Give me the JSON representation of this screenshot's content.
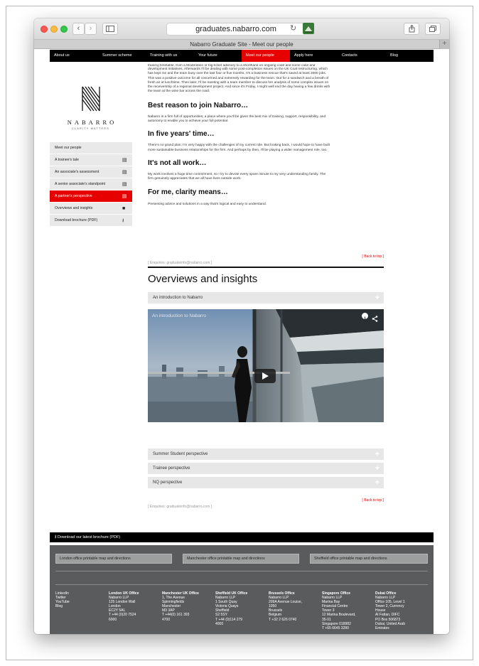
{
  "browser": {
    "url": "graduates.nabarro.com",
    "tab_title": "Nabarro Graduate Site - Meet our people",
    "back": "‹",
    "forward": "›",
    "reload": "↻",
    "new_tab": "+"
  },
  "nav": {
    "items": [
      "About us",
      "Summer scheme",
      "Training with us",
      "Your future",
      "Meet our people",
      "Apply here",
      "Contacts",
      "Blog"
    ],
    "active_index": 4,
    "active_color": "#e60000"
  },
  "logo": {
    "name": "NABARRO",
    "tagline": "CLARITY MATTERS"
  },
  "sidebar": {
    "items": [
      {
        "label": "Meet our people",
        "icon": ""
      },
      {
        "label": "A trainee's tale",
        "icon": "document-icon"
      },
      {
        "label": "An associate's assessment",
        "icon": "document-icon"
      },
      {
        "label": "A senior associate's standpoint",
        "icon": "document-icon"
      },
      {
        "label": "A partner's perspective",
        "icon": "document-icon"
      },
      {
        "label": "Overviews and insights",
        "icon": "video-icon"
      },
      {
        "label": "Download brochure (PDF)",
        "icon": "download-icon"
      }
    ],
    "active_index": 4
  },
  "article": {
    "intro_lines": [
      "training timetable, from a Moderation or big-ticket advisory to a shorthand on ongoing code and some case and",
      "development initiatives. Afterwards I'll be dealing with some post-completion issues on the UK Coal restructuring, which",
      "has kept me and the team busy over the last four or five months. It's a business rescue that's saved at least 2000 jobs.",
      "This was a positive outcome for all concerned and extremely rewarding for the team. Out for a sandwich and a breath of",
      "fresh air at lunchtime. Then later, I'll be meeting with a team member to discuss her analysis of some complex issues on",
      "the receivership of a regional development project. And since it's Friday, I might well end the day having a few drinks with",
      "the team at the wine bar across the road."
    ],
    "sections": [
      {
        "heading": "Best reason to join Nabarro…",
        "lines": [
          "Nabarro is a firm full of opportunities; a place where you'll be given the best mix of training, support, responsibility, and",
          "autonomy to enable you to achieve your full potential."
        ]
      },
      {
        "heading": "In five years' time…",
        "lines": [
          "There's no grand plan; I'm very happy with the challenges of my current role. But looking back, I would hope to have built",
          "more sustainable business relationships for the firm. And perhaps by then, I'll be playing a wider management role, too."
        ]
      },
      {
        "heading": "It's not all work…",
        "lines": [
          "My work involves a huge time commitment, so I try to devote every spare minute to my very understanding family. The",
          "firm genuinely appreciates that we all have lives outside work."
        ]
      },
      {
        "heading": "For me, clarity means…",
        "lines": [
          "Presenting advice and solutions in a way that's logical and easy to understand."
        ]
      }
    ],
    "enquiries": "[ Enquiries: graduateinfo@nabarro.com ]",
    "back_to_top": "[ Back to top ]"
  },
  "overviews": {
    "heading": "Overviews and insights",
    "accordion_first": "An introduction to Nabarro",
    "video_title": "An introduction to Nabarro",
    "accordion_rest": [
      "Summer Student perspective",
      "Trainee perspective",
      "NQ perspective"
    ],
    "enquiries": "[ Enquiries: graduateinfo@nabarro.com ]",
    "back_to_top": "[ Back to top ]"
  },
  "download_bar": {
    "label": "Download our latest brochure (PDF)"
  },
  "footer": {
    "map_buttons": [
      "London office printable map and directions",
      "Manchester office printable map and directions",
      "Sheffield office printable map and directions"
    ],
    "social": [
      "LinkedIn",
      "Twitter",
      "YouTube",
      "Blog"
    ],
    "offices": [
      {
        "title": "London UK Office",
        "lines": [
          "Nabarro LLP",
          "125 London Wall",
          "London",
          "EC2Y 5AL",
          "T +44 (0)20 7524",
          "6000"
        ]
      },
      {
        "title": "Manchester UK Office",
        "lines": [
          "1, The Avenue",
          "Spinningfields",
          "Manchester",
          "M3 3AP",
          "T +44(0) 161 393",
          "4700"
        ]
      },
      {
        "title": "Sheffield UK Office",
        "lines": [
          "Nabarro LLP",
          "1 South Quay",
          "Victoria Quays",
          "Sheffield",
          "S2 5SY",
          "T +44 (0)114 279",
          "4000"
        ]
      },
      {
        "title": "Brussels Office",
        "lines": [
          "Nabarro LLP",
          "209A Avenue Louise,",
          "1050",
          "Brussels",
          "Belgium",
          "T +32 2 626 0740"
        ]
      },
      {
        "title": "Singapore Office",
        "lines": [
          "Nabarro LLP",
          "Marina Bay",
          "Financial Centre",
          "Tower 3",
          "12 Marina Boulevard,",
          "35-01",
          "Singapore 018982",
          "T +65 6645 3280"
        ]
      },
      {
        "title": "Dubai Office",
        "lines": [
          "Nabarro LLP",
          "Office 105, Level 1",
          "Tower 2, Currency",
          "House",
          "Al Fattan, DIFC",
          "PO Box 506873",
          "Dubai, United Arab",
          "Emirates"
        ]
      }
    ]
  }
}
